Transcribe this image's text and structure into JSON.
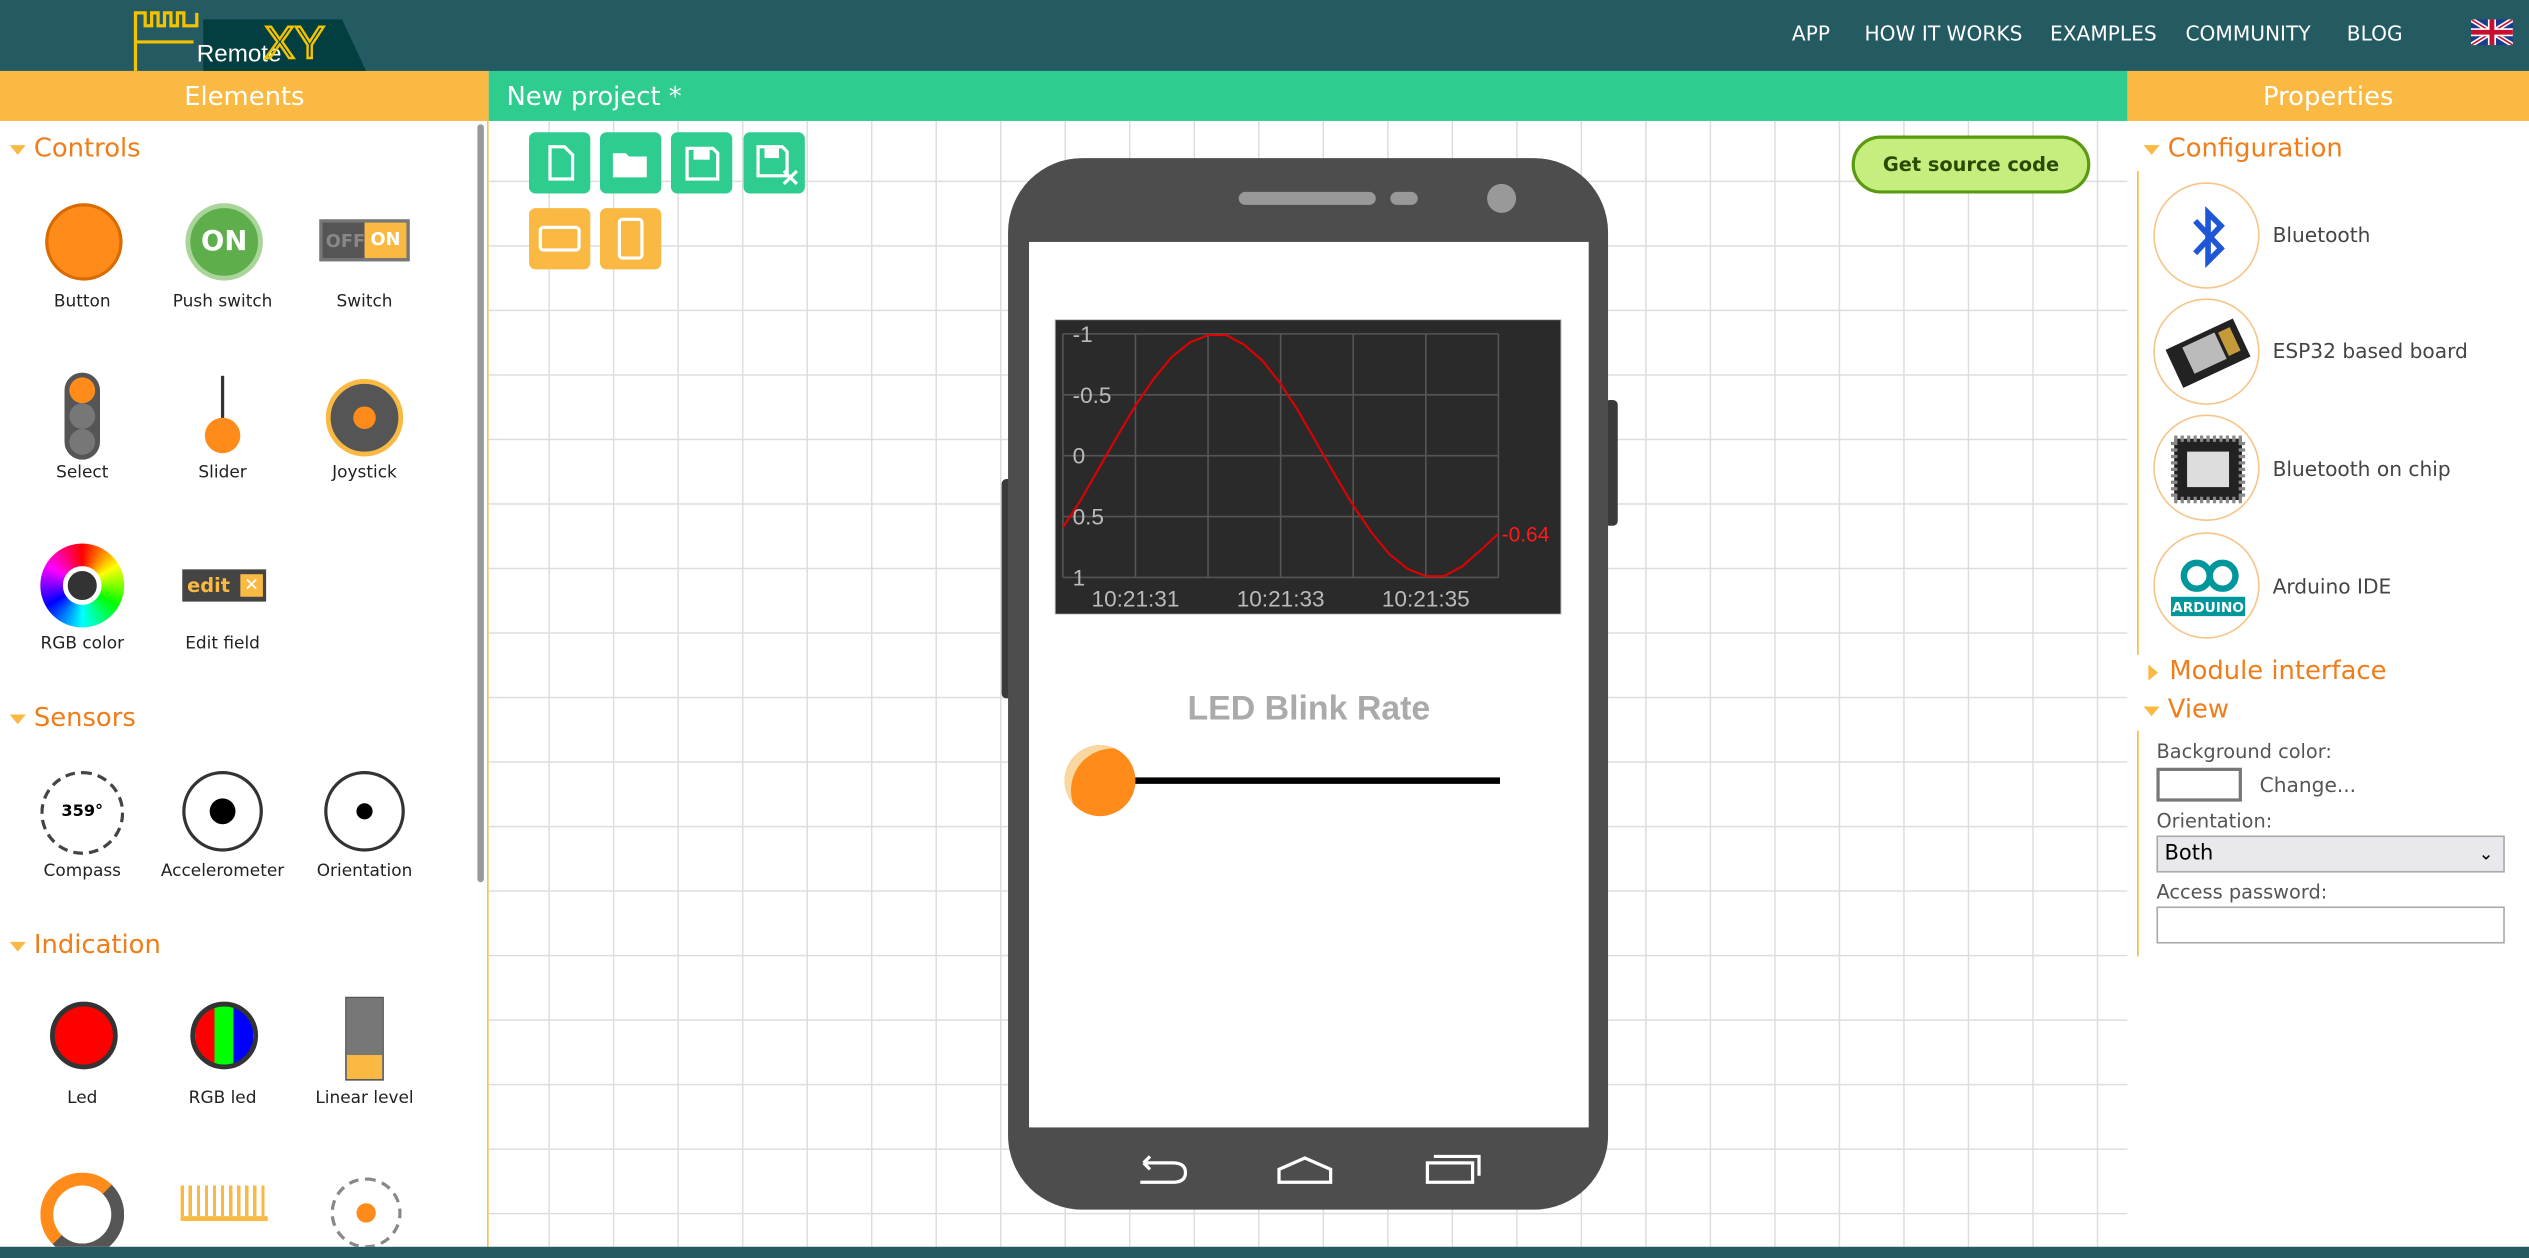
{
  "header": {
    "logo_text": "RemoteXY",
    "nav": [
      "APP",
      "HOW IT WORKS",
      "EXAMPLES",
      "COMMUNITY",
      "BLOG"
    ],
    "language_icon": "uk-flag-icon"
  },
  "left_panel": {
    "title": "Elements",
    "sections": [
      {
        "title": "Controls",
        "items": [
          "Button",
          "Push switch",
          "Switch",
          "Select",
          "Slider",
          "Joystick",
          "RGB color",
          "Edit field"
        ]
      },
      {
        "title": "Sensors",
        "items": [
          "Compass",
          "Accelerometer",
          "Orientation"
        ]
      },
      {
        "title": "Indication",
        "items": [
          "Led",
          "RGB led",
          "Linear level"
        ]
      }
    ],
    "icon_texts": {
      "push_switch": "ON",
      "switch_off": "OFF",
      "switch_on": "ON",
      "edit": "edit",
      "compass": "359°"
    }
  },
  "center": {
    "title": "New project *",
    "get_source_label": "Get source code",
    "toolbar": [
      "new-file-icon",
      "open-folder-icon",
      "save-icon",
      "save-as-icon",
      "landscape-icon",
      "portrait-icon"
    ],
    "phone": {
      "label": "LED Blink Rate",
      "slider_value": 0,
      "nav_icons": [
        "back-icon",
        "home-icon",
        "recent-apps-icon"
      ]
    }
  },
  "chart_data": {
    "type": "line",
    "x_tick_labels": [
      "10:21:31",
      "10:21:33",
      "10:21:35"
    ],
    "y_tick_labels": [
      "-1",
      "-0.5",
      "0",
      "0.5",
      "1"
    ],
    "ylim": [
      -1,
      1
    ],
    "xlim": [
      30,
      36
    ],
    "grid": true,
    "line_color": "#e00000",
    "background": "#2a2a2a",
    "last_value_label": "-0.64",
    "x": [
      30,
      30.25,
      30.5,
      30.75,
      31,
      31.25,
      31.5,
      31.75,
      32,
      32.25,
      32.5,
      32.75,
      33,
      33.25,
      33.5,
      33.75,
      34,
      34.25,
      34.5,
      34.75,
      35,
      35.25,
      35.5,
      35.75,
      36
    ],
    "y": [
      -0.59,
      -0.36,
      -0.1,
      0.16,
      0.41,
      0.63,
      0.81,
      0.93,
      0.99,
      0.99,
      0.91,
      0.78,
      0.59,
      0.36,
      0.1,
      -0.16,
      -0.41,
      -0.63,
      -0.81,
      -0.93,
      -0.99,
      -0.99,
      -0.91,
      -0.78,
      -0.64
    ]
  },
  "right_panel": {
    "title": "Properties",
    "configuration": {
      "title": "Configuration",
      "items": [
        "Bluetooth",
        "ESP32 based board",
        "Bluetooth on chip",
        "Arduino IDE"
      ],
      "arduino_logo_text": "ARDUINO"
    },
    "module_interface": "Module interface",
    "view": {
      "title": "View",
      "bg_color_label": "Background color:",
      "change_label": "Change...",
      "orientation_label": "Orientation:",
      "orientation_value": "Both",
      "password_label": "Access password:",
      "password_value": ""
    }
  },
  "colors": {
    "header": "#245a62",
    "orange": "#f9b942",
    "green": "#2ecc8f",
    "accent_text": "#ef7d1a"
  }
}
